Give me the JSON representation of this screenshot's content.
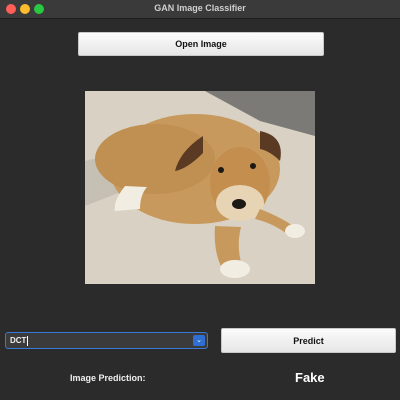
{
  "window": {
    "title": "GAN Image Classifier"
  },
  "toolbar": {
    "open_label": "Open Image"
  },
  "image": {
    "description_icon": "photo-icon"
  },
  "method": {
    "selected": "DCT"
  },
  "predict": {
    "label": "Predict"
  },
  "result": {
    "label": "Image Prediction:",
    "value": "Fake"
  },
  "colors": {
    "background": "#2b2b2b",
    "accent": "#3a78d6",
    "button": "#f2f2f2",
    "text": "#ffffff"
  }
}
